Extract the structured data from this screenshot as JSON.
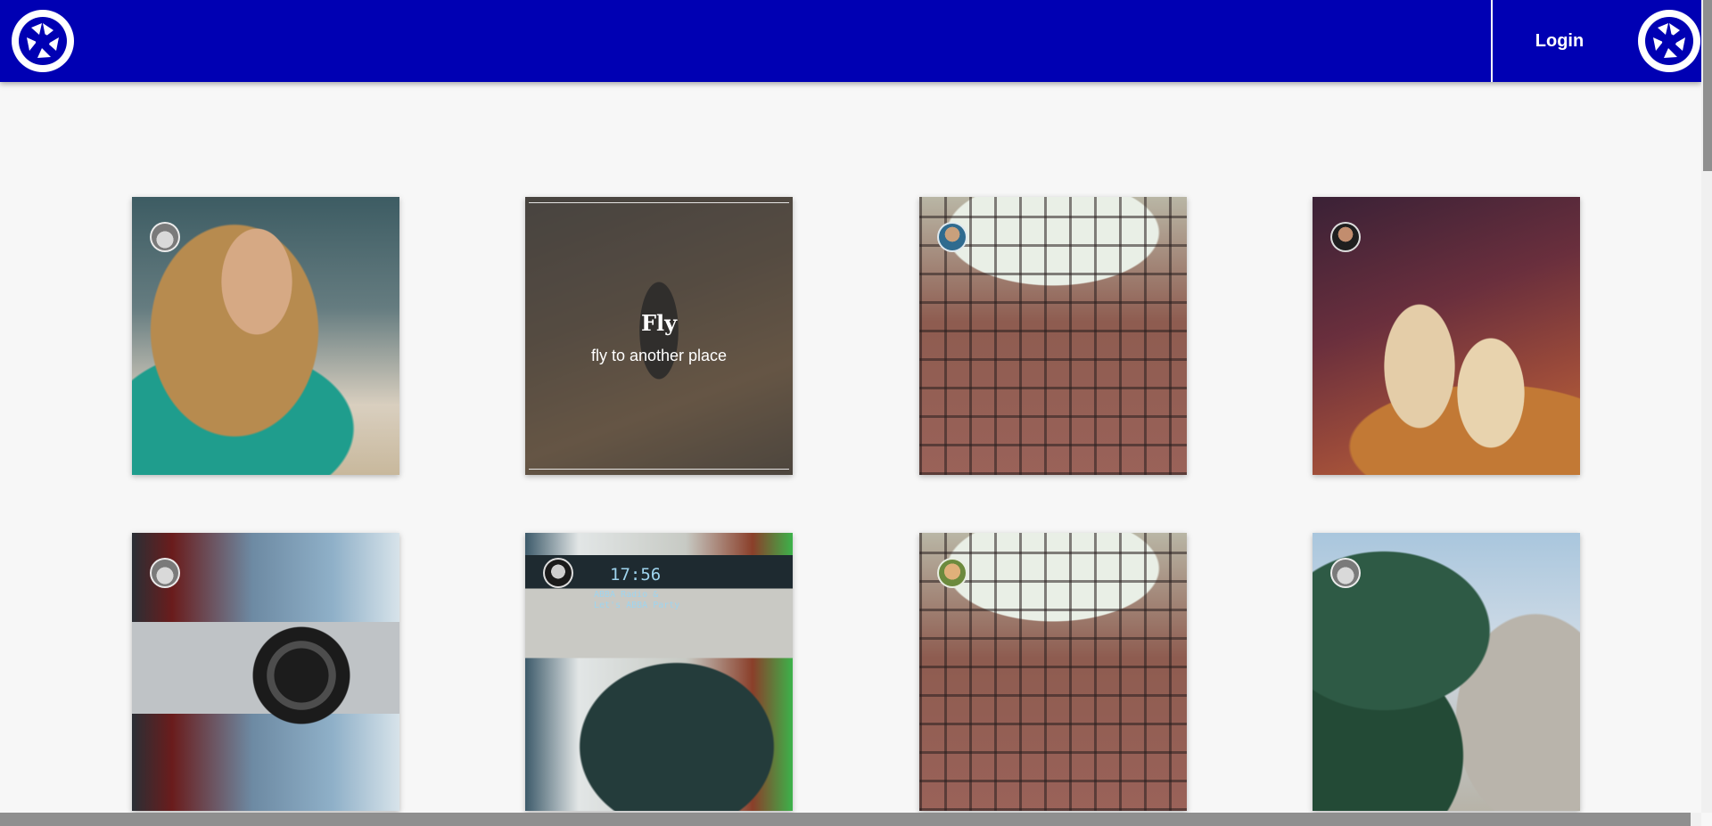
{
  "header": {
    "login_label": "Login",
    "background_color": "#0000b3",
    "logo_icon": "camera-aperture-icon"
  },
  "grid": {
    "cards": [
      {
        "image": "woman-with-laptop-and-dog",
        "avatar": "avatar-1"
      },
      {
        "image": "hiker-on-trail",
        "overlay": {
          "title": "Fly",
          "subtitle": "fly to another place"
        }
      },
      {
        "image": "plants-on-grid",
        "avatar": "avatar-2"
      },
      {
        "image": "coffee-cups",
        "avatar": "avatar-3"
      },
      {
        "image": "hands-holding-camera",
        "avatar": "avatar-1"
      },
      {
        "image": "retro-radio",
        "avatar": "avatar-4",
        "screen": {
          "time": "17:56",
          "line1": "ABBA Radio &",
          "line2": "Let's ABBA Party"
        }
      },
      {
        "image": "plants-on-grid",
        "avatar": "avatar-5"
      },
      {
        "image": "palm-trees-mountains",
        "avatar": "avatar-1"
      }
    ]
  }
}
